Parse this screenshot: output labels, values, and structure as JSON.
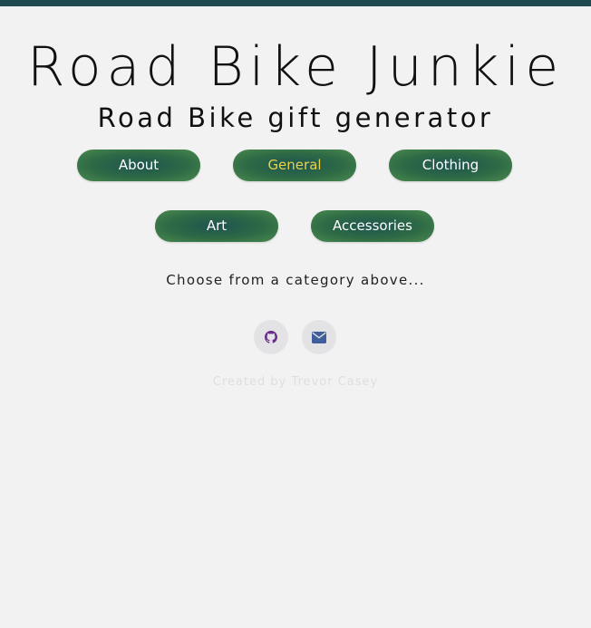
{
  "header": {
    "title": "Road Bike Junkie",
    "subtitle": "Road Bike gift generator"
  },
  "nav": {
    "about": "About",
    "general": "General",
    "clothing": "Clothing",
    "art": "Art",
    "accessories": "Accessories",
    "active": "General"
  },
  "main": {
    "prompt": "Choose from a category above..."
  },
  "social": {
    "github_icon": "github-icon",
    "email_icon": "envelope-icon"
  },
  "footer": {
    "credit": "Created by Trevor Casey"
  },
  "colors": {
    "topbar": "#1f4a4f",
    "button_green": "#2e6a45",
    "active_text": "#e8d24a",
    "github_icon": "#6a2b8a",
    "email_icon": "#3f5e9a"
  }
}
